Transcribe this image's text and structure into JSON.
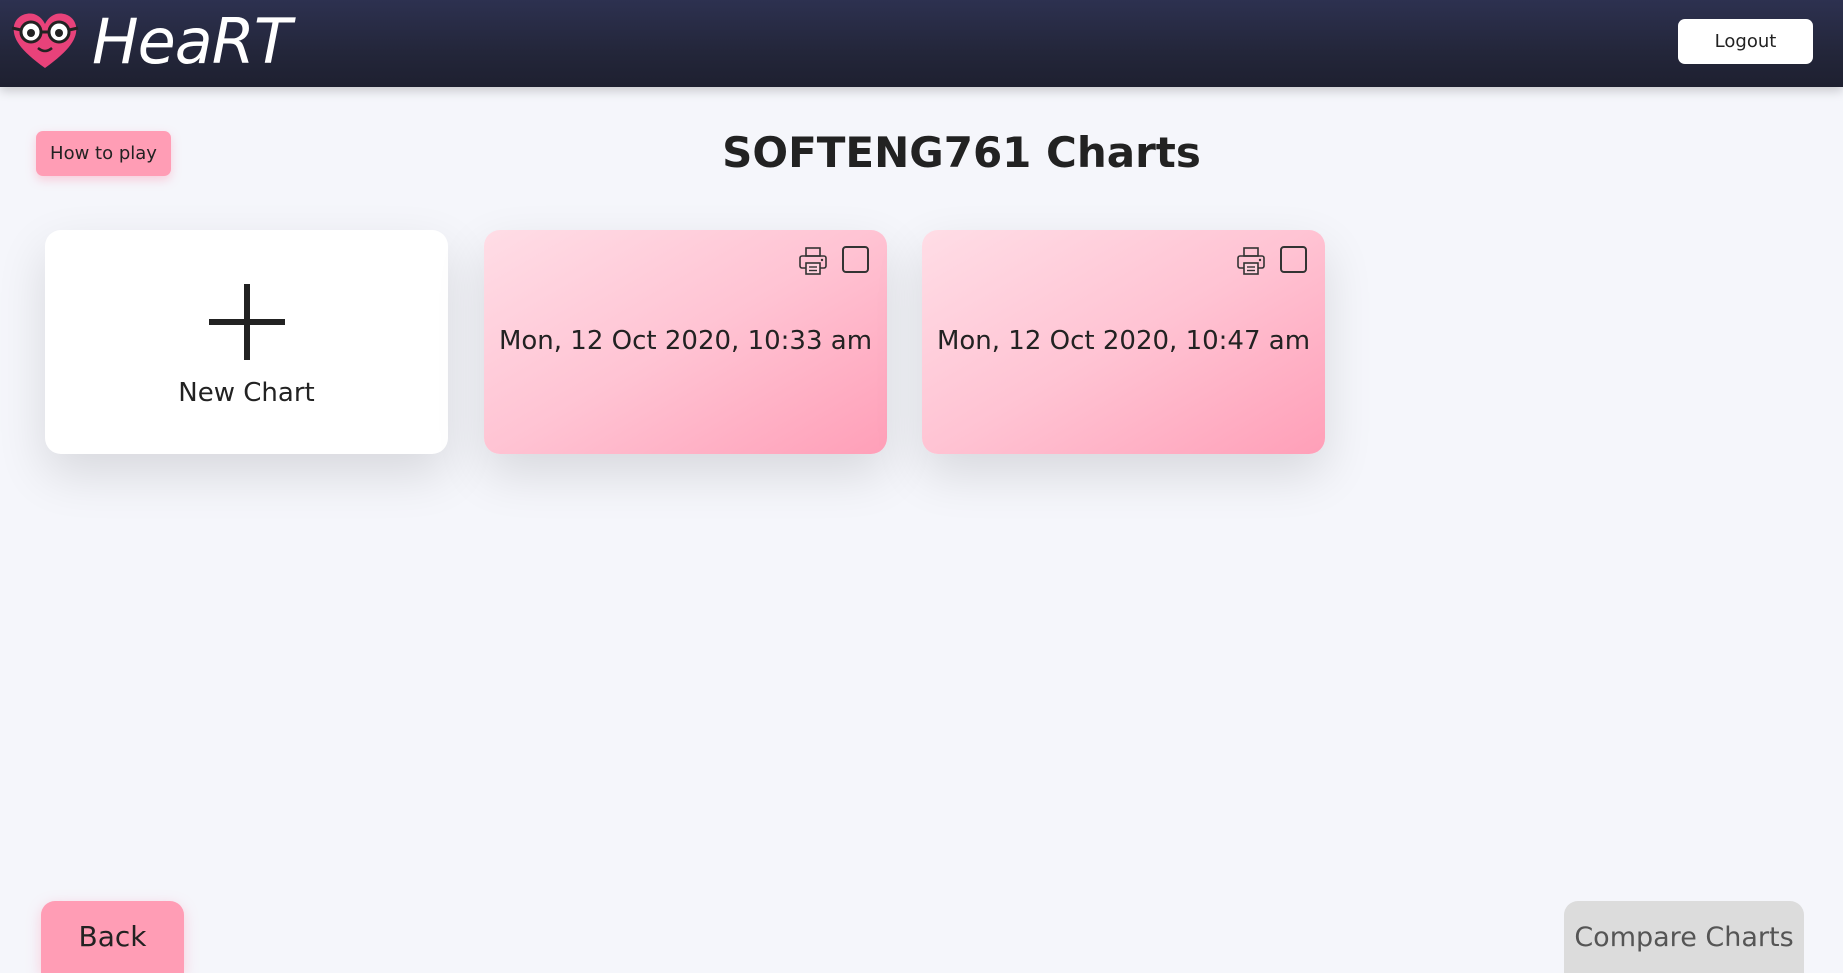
{
  "header": {
    "app_name": "HeaRT",
    "logout_label": "Logout"
  },
  "page": {
    "title": "SOFTENG761 Charts",
    "how_to_play_label": "How to play"
  },
  "new_chart": {
    "label": "New Chart"
  },
  "charts": [
    {
      "date": "Mon, 12 Oct 2020, 10:33 am",
      "selected": false
    },
    {
      "date": "Mon, 12 Oct 2020, 10:47 am",
      "selected": false
    }
  ],
  "footer": {
    "back_label": "Back",
    "compare_label": "Compare Charts"
  },
  "icons": {
    "logo": "heart-with-glasses-icon",
    "new": "plus-icon",
    "print": "printer-icon",
    "select": "checkbox-icon"
  },
  "colors": {
    "header_bg": "#23263a",
    "accent_pink": "#ff9db5",
    "disabled_gray": "#dcdcdc"
  }
}
